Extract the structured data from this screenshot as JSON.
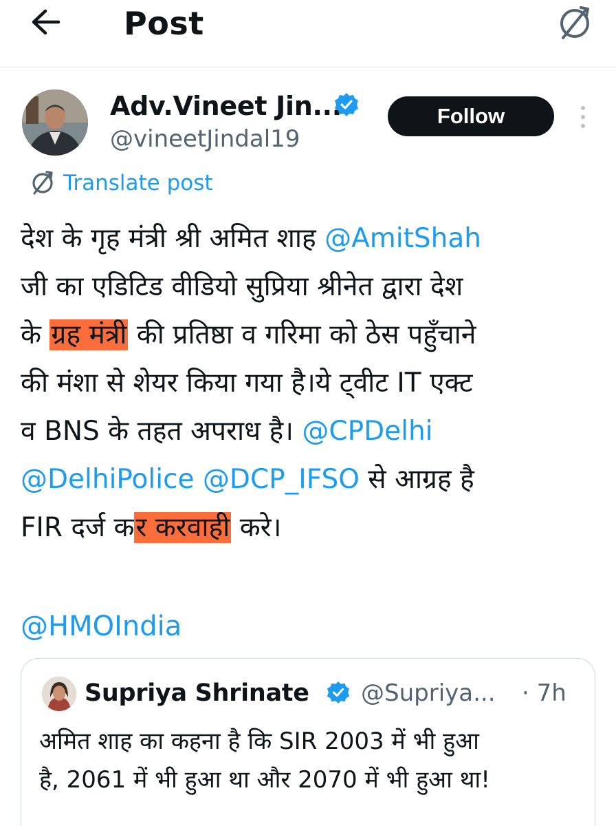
{
  "header": {
    "title": "Post",
    "back_icon": "arrow-left-icon",
    "translate_icon": "translate-icon"
  },
  "author": {
    "name": "Adv.Vineet Jin...",
    "handle": "@vineetJindal19",
    "verified": true,
    "follow_label": "Follow"
  },
  "translate": {
    "label": "Translate post"
  },
  "post": {
    "lines": [
      [
        {
          "t": "देश के गृह मंत्री श्री अमित शाह "
        },
        {
          "t": "@AmitShah",
          "mention": true
        }
      ],
      [
        {
          "t": "जी का एडिटिड वीडियो सुप्रिया श्रीनेत द्वारा देश"
        }
      ],
      [
        {
          "t": "के "
        },
        {
          "t": "ग्रह मंत्री",
          "highlight": true
        },
        {
          "t": " की प्रतिष्ठा व गरिमा को ठेस पहुँचाने"
        }
      ],
      [
        {
          "t": "की मंशा से शेयर किया गया है।ये ट्वीट IT एक्ट"
        }
      ],
      [
        {
          "t": "व BNS के तहत अपराध है। "
        },
        {
          "t": "@CPDelhi",
          "mention": true
        }
      ],
      [
        {
          "t": "@DelhiPolice",
          "mention": true
        },
        {
          "t": " "
        },
        {
          "t": "@DCP_IFSO",
          "mention": true
        },
        {
          "t": " से आग्रह है"
        }
      ],
      [
        {
          "t": "FIR दर्ज क"
        },
        {
          "t": "र करवाही",
          "highlight": true
        },
        {
          "t": " करे।"
        }
      ]
    ],
    "tail_mention": "@HMOIndia"
  },
  "quote": {
    "name": "Supriya Shrinate",
    "handle": "@Supriya...",
    "time": "· 7h",
    "verified": true,
    "lines": [
      "अमित शाह का कहना है कि SIR 2003 में भी हुआ",
      "है, 2061 में भी हुआ था और 2070 में भी हुआ था!"
    ]
  },
  "colors": {
    "link": "#1d9bf0",
    "highlight": "#fb6d3a",
    "text": "#0f1419",
    "muted": "#536471",
    "follow_bg": "#0f1419"
  }
}
